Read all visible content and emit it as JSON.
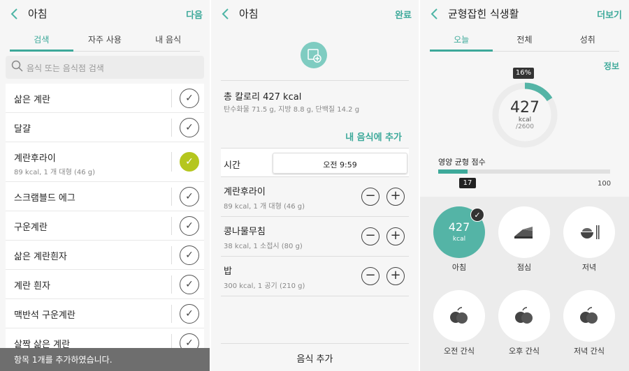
{
  "left": {
    "title": "아침",
    "action": "다음",
    "tabs": [
      "검색",
      "자주 사용",
      "내 음식"
    ],
    "search_placeholder": "음식 또는 음식점 검색",
    "items": [
      {
        "name": "삶은 계란",
        "sub": "",
        "checked": false
      },
      {
        "name": "달걀",
        "sub": "",
        "checked": false
      },
      {
        "name": "계란후라이",
        "sub": "89 kcal, 1 개 대형 (46 g)",
        "checked": true
      },
      {
        "name": "스크램블드 에그",
        "sub": "",
        "checked": false
      },
      {
        "name": "구운계란",
        "sub": "",
        "checked": false
      },
      {
        "name": "삶은 계란흰자",
        "sub": "",
        "checked": false
      },
      {
        "name": "계란 흰자",
        "sub": "",
        "checked": false
      },
      {
        "name": "맥반석 구운계란",
        "sub": "",
        "checked": false
      },
      {
        "name": "살짝 삶은 계란",
        "sub": "",
        "checked": false
      }
    ],
    "toast": "항목 1개를 추가하였습니다."
  },
  "middle": {
    "title": "아침",
    "action": "완료",
    "total": "총 칼로리 427 kcal",
    "macros": "탄수화물 71.5 g, 지방 8.8 g, 단백질 14.2 g",
    "add_my": "내 음식에 추가",
    "time_label": "시간",
    "time_value": "오전 9:59",
    "items": [
      {
        "name": "계란후라이",
        "sub": "89 kcal, 1 개 대형 (46 g)"
      },
      {
        "name": "콩나물무침",
        "sub": "38 kcal, 1 소접시 (80 g)"
      },
      {
        "name": "밥",
        "sub": "300 kcal, 1 공기 (210 g)"
      }
    ],
    "minus": "−",
    "plus": "+",
    "footer": "음식 추가"
  },
  "right": {
    "title": "균형잡힌 식생활",
    "action": "더보기",
    "tabs": [
      "오늘",
      "전체",
      "성취"
    ],
    "info": "정보",
    "percent": "16%",
    "percent_value": 16,
    "kcal": "427",
    "kcal_unit": "kcal",
    "goal": "/2600",
    "score_label": "영양 균형 점수",
    "score": "17",
    "score_value": 17,
    "score_max": "100",
    "meals": [
      {
        "label": "아침",
        "kcal": "427",
        "unit": "kcal",
        "selected": true,
        "icon": "check"
      },
      {
        "label": "점심",
        "icon": "sandwich-icon"
      },
      {
        "label": "저녁",
        "icon": "rice-bowl-icon"
      },
      {
        "label": "오전 간식",
        "icon": "fruit-icon"
      },
      {
        "label": "오후 간식",
        "icon": "fruit-icon"
      },
      {
        "label": "저녁 간식",
        "icon": "fruit-icon"
      }
    ]
  },
  "colors": {
    "accent": "#3da99a",
    "check_on": "#b5c61e"
  }
}
